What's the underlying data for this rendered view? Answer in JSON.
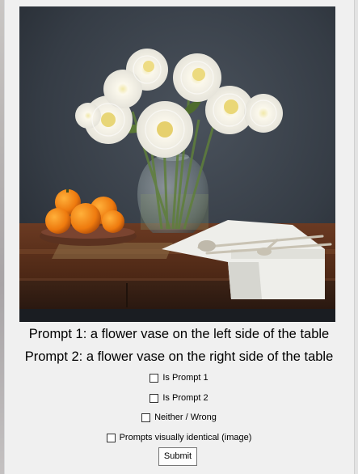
{
  "image": {
    "subject": "flower-vase-still-life"
  },
  "prompts": {
    "prompt1": "Prompt 1: a flower vase on the left side of the table",
    "prompt2": "Prompt 2: a flower vase on the right side of the table"
  },
  "options": [
    {
      "label": "Is Prompt 1",
      "checked": false
    },
    {
      "label": "Is Prompt 2",
      "checked": false
    },
    {
      "label": "Neither / Wrong",
      "checked": false
    },
    {
      "label": "Prompts visually identical (image)",
      "checked": false
    }
  ],
  "submit": {
    "label": "Submit"
  }
}
